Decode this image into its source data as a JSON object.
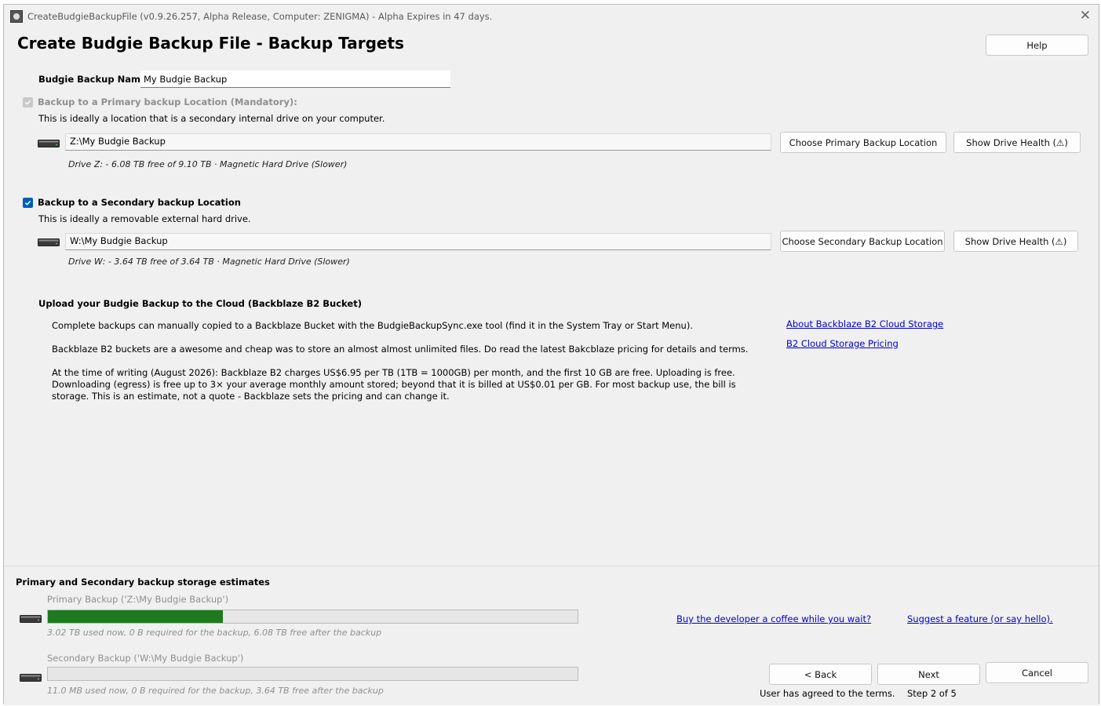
{
  "window": {
    "title": "CreateBudgieBackupFile (v0.9.26.257, Alpha Release, Computer: ZENIGMA) - Alpha Expires in 47 days."
  },
  "header": {
    "title": "Create Budgie Backup File  - Backup Targets",
    "help_label": "Help"
  },
  "backup_name": {
    "label": "Budgie Backup Name:",
    "value": "My Budgie Backup"
  },
  "primary": {
    "checkbox_label": "Backup to a Primary backup Location (Mandatory):",
    "checked": true,
    "disabled": true,
    "description": "This is ideally a location that is a secondary internal drive on your computer.",
    "path": "Z:\\My Budgie Backup",
    "drive_info": "Drive Z: - 6.08 TB free of 9.10 TB  ·  Magnetic Hard Drive (Slower)",
    "choose_label": "Choose Primary Backup Location",
    "health_label": "Show Drive Health (⚠)"
  },
  "secondary": {
    "checkbox_label": "Backup to a Secondary backup Location",
    "checked": true,
    "description": "This is ideally a removable external hard drive.",
    "path": "W:\\My Budgie Backup",
    "drive_info": "Drive W: - 3.64 TB free of 3.64 TB  ·  Magnetic Hard Drive (Slower)",
    "choose_label": "Choose Secondary Backup Location",
    "health_label": "Show Drive Health (⚠)"
  },
  "cloud": {
    "heading": "Upload your Budgie Backup to the Cloud (Backblaze B2 Bucket)",
    "para1": "Complete backups can manually copied to a Backblaze Bucket with the BudgieBackupSync.exe tool (find it in the System Tray or Start Menu).",
    "para2": "Backblaze B2 buckets are a awesome and cheap was to store an almost almost unlimited files. Do read the latest Bakcblaze pricing for details and terms.",
    "para3": "At the time of writing (August 2026): Backblaze B2 charges US$6.95 per TB (1TB = 1000GB) per month, and the first 10 GB are free. Uploading is free. Downloading (egress) is free up to 3× your average monthly amount stored; beyond that it is billed at US$0.01 per GB. For most backup use, the bill is storage. This is an estimate, not a quote - Backblaze sets the pricing and can change it.",
    "link_about": "About Backblaze B2 Cloud Storage",
    "link_pricing": "B2 Cloud Storage Pricing"
  },
  "estimates": {
    "heading": "Primary and Secondary backup storage estimates",
    "primary_label": "Primary Backup ('Z:\\My Budgie Backup')",
    "primary_fill_fraction": 0.33,
    "primary_detail": "3.02 TB used now, 0 B required for the backup, 6.08 TB free after the backup",
    "secondary_label": "Secondary Backup ('W:\\My Budgie Backup')",
    "secondary_fill_fraction": 0.0,
    "secondary_detail": "11.0 MB used now, 0 B required for the backup, 3.64 TB free after the backup"
  },
  "footer": {
    "coffee_link": "Buy the developer a coffee while you wait?",
    "suggest_link": "Suggest a feature (or say hello).",
    "back_label": "< Back",
    "next_label": "Next",
    "cancel_label": "Cancel",
    "terms_status": "User has agreed to the terms.",
    "step": "Step 2 of 5"
  },
  "colors": {
    "accent": "#005fb8",
    "progress_green": "#06b025",
    "link": "#0000cc"
  }
}
